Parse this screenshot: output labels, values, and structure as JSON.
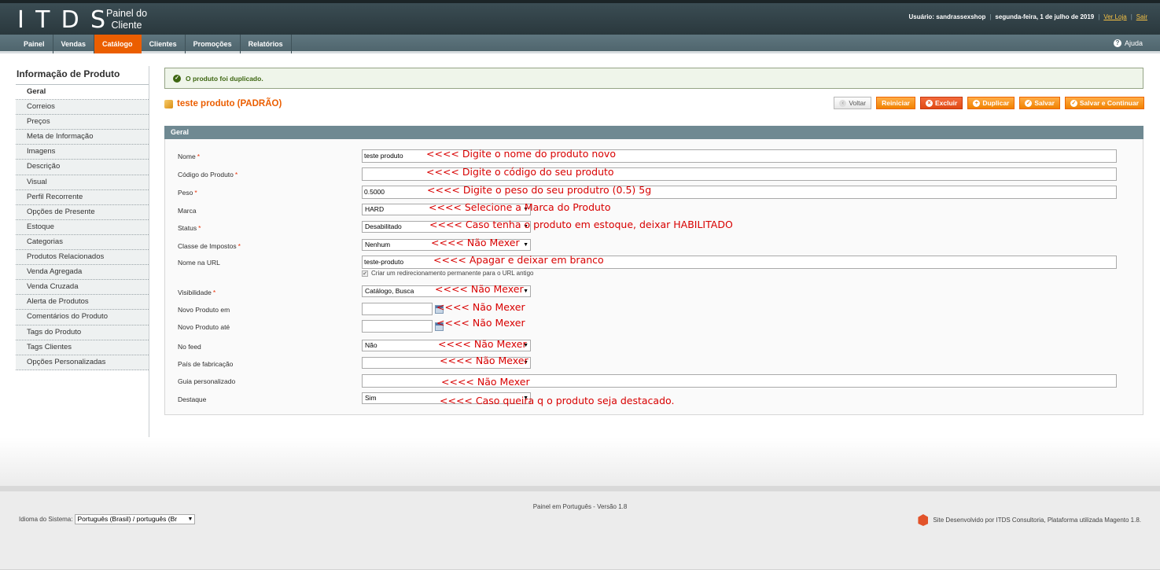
{
  "header": {
    "logo_letters": [
      "I",
      "T",
      "D",
      "S"
    ],
    "logo_sub": "Painel do Cliente",
    "user_label": "Usuário: sandrassexshop",
    "date": "segunda-feira, 1 de julho de 2019",
    "view_store": "Ver Loja",
    "logout": "Sair"
  },
  "nav": {
    "items": [
      "Painel",
      "Vendas",
      "Catálogo",
      "Clientes",
      "Promoções",
      "Relatórios"
    ],
    "active_index": 2,
    "help": "Ajuda"
  },
  "sidebar": {
    "title": "Informação de Produto",
    "tabs": [
      "Geral",
      "Correios",
      "Preços",
      "Meta de Informação",
      "Imagens",
      "Descrição",
      "Visual",
      "Perfil Recorrente",
      "Opções de Presente",
      "Estoque",
      "Categorias",
      "Produtos Relacionados",
      "Venda Agregada",
      "Venda Cruzada",
      "Alerta de Produtos",
      "Comentários do Produto",
      "Tags do Produto",
      "Tags Clientes",
      "Opções Personalizadas"
    ]
  },
  "message": {
    "success": "O produto foi duplicado."
  },
  "page": {
    "title": "teste produto (PADRÃO)"
  },
  "buttons": {
    "back": "Voltar",
    "reset": "Reiniciar",
    "delete": "Excluir",
    "duplicate": "Duplicar",
    "save": "Salvar",
    "save_continue": "Salvar e Continuar"
  },
  "form": {
    "section": "Geral",
    "name": {
      "label": "Nome",
      "value": "teste produto",
      "hint": "<<<< Digite o nome do produto novo"
    },
    "sku": {
      "label": "Código do Produto",
      "value": "",
      "hint": "<<<< Digite o código do seu produto"
    },
    "weight": {
      "label": "Peso",
      "value": "0.5000",
      "hint": "<<<< Digite o peso do seu produtro (0.5) 5g"
    },
    "brand": {
      "label": "Marca",
      "value": "HARD",
      "hint": "<<<< Selecione a Marca do Produto"
    },
    "status": {
      "label": "Status",
      "value": "Desabilitado",
      "hint": "<<<< Caso tenha o produto em estoque, deixar HABILITADO"
    },
    "tax": {
      "label": "Classe de Impostos",
      "value": "Nenhum",
      "hint": "<<<< Não Mexer"
    },
    "url": {
      "label": "Nome na URL",
      "value": "teste-produto",
      "hint": "<<<< Apagar e deixar em branco",
      "redirect": "Criar um redirecionamento permanente para o URL antigo",
      "check_mark": "✔"
    },
    "visibility": {
      "label": "Visibilidade",
      "value": "Catálogo, Busca",
      "hint": "<<<< Não Mexer"
    },
    "new_from": {
      "label": "Novo Produto em",
      "value": "",
      "hint": "<<<< Não Mexer"
    },
    "new_to": {
      "label": "Novo Produto até",
      "value": "",
      "hint": "<<<< Não Mexer"
    },
    "feed": {
      "label": "No feed",
      "value": "Não",
      "hint": "<<<< Não Mexer"
    },
    "country": {
      "label": "País de fabricação",
      "value": "",
      "hint": "<<<< Não Mexer"
    },
    "guide": {
      "label": "Guia personalizado",
      "value": "",
      "hint": "<<<< Não Mexer"
    },
    "featured": {
      "label": "Destaque",
      "value": "Sim",
      "hint": "<<<< Caso queira q o produto seja destacado."
    }
  },
  "footer": {
    "version": "Painel em Português - Versão 1.8",
    "lang_label": "Idioma do Sistema:",
    "lang_value": "Português (Brasil) / português (Br",
    "credit": "Site Desenvolvido por ITDS Consultoria, Plataforma utilizada Magento 1.8."
  },
  "colors": {
    "accent": "#eb5e00",
    "hint": "#d80000",
    "header": "#2a383d"
  }
}
